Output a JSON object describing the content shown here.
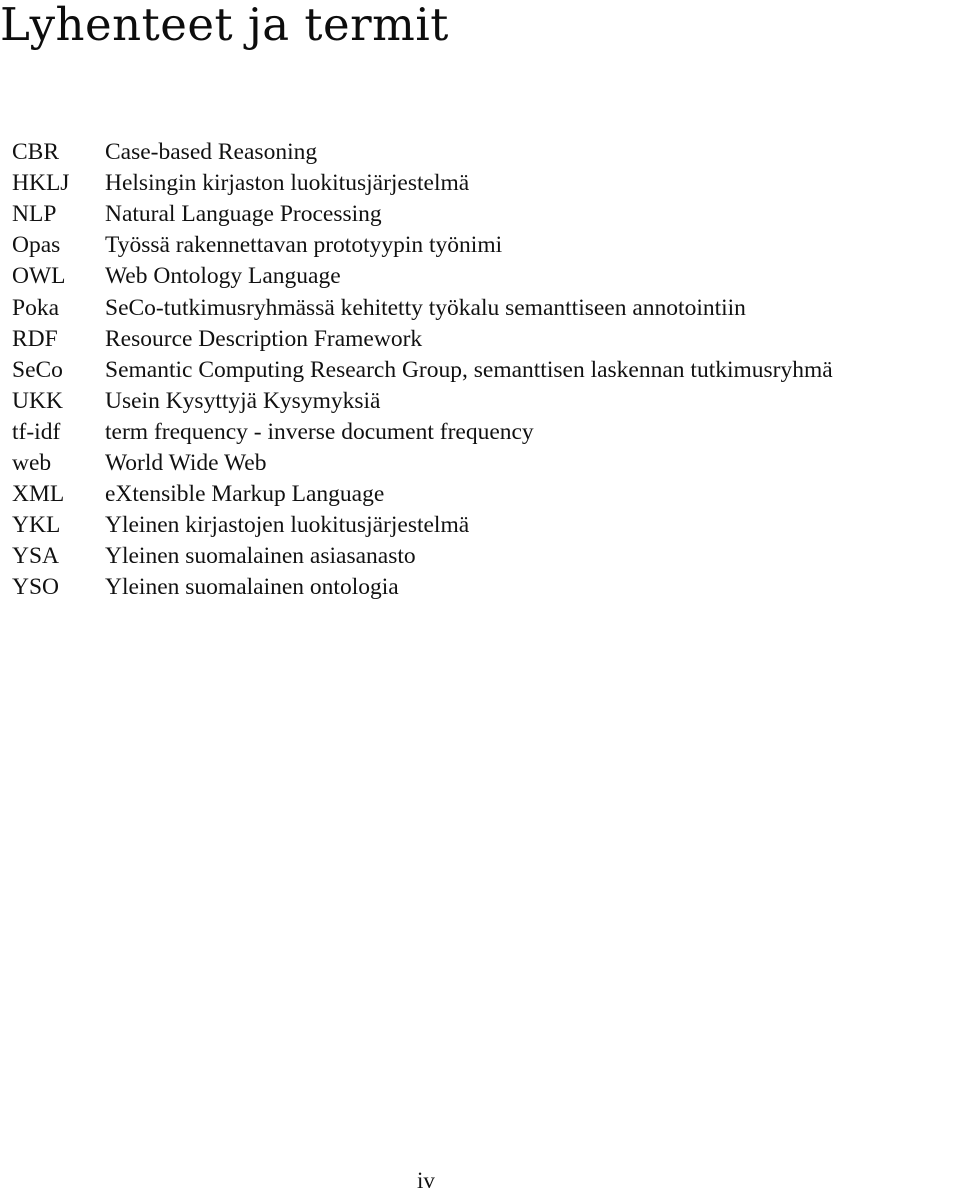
{
  "page": {
    "title": "Lyhenteet ja termit",
    "page_number": "iv"
  },
  "abbreviations": [
    {
      "abbr": "CBR",
      "definition": "Case-based Reasoning"
    },
    {
      "abbr": "HKLJ",
      "definition": "Helsingin kirjaston luokitusjärjestelmä"
    },
    {
      "abbr": "NLP",
      "definition": "Natural Language Processing"
    },
    {
      "abbr": "Opas",
      "definition": "Työssä rakennettavan prototyypin työnimi"
    },
    {
      "abbr": "OWL",
      "definition": "Web Ontology Language"
    },
    {
      "abbr": "Poka",
      "definition": "SeCo-tutkimusryhmässä kehitetty työkalu semanttiseen annotointiin"
    },
    {
      "abbr": "RDF",
      "definition": "Resource Description Framework"
    },
    {
      "abbr": "SeCo",
      "definition": "Semantic Computing Research Group, semanttisen laskennan tutkimusryhmä"
    },
    {
      "abbr": "UKK",
      "definition": "Usein Kysyttyjä Kysymyksiä"
    },
    {
      "abbr": "tf-idf",
      "definition": "term frequency - inverse document frequency"
    },
    {
      "abbr": "web",
      "definition": "World Wide Web"
    },
    {
      "abbr": "XML",
      "definition": "eXtensible Markup Language"
    },
    {
      "abbr": "YKL",
      "definition": "Yleinen kirjastojen luokitusjärjestelmä"
    },
    {
      "abbr": "YSA",
      "definition": "Yleinen suomalainen asiasanasto"
    },
    {
      "abbr": "YSO",
      "definition": "Yleinen suomalainen ontologia"
    }
  ]
}
